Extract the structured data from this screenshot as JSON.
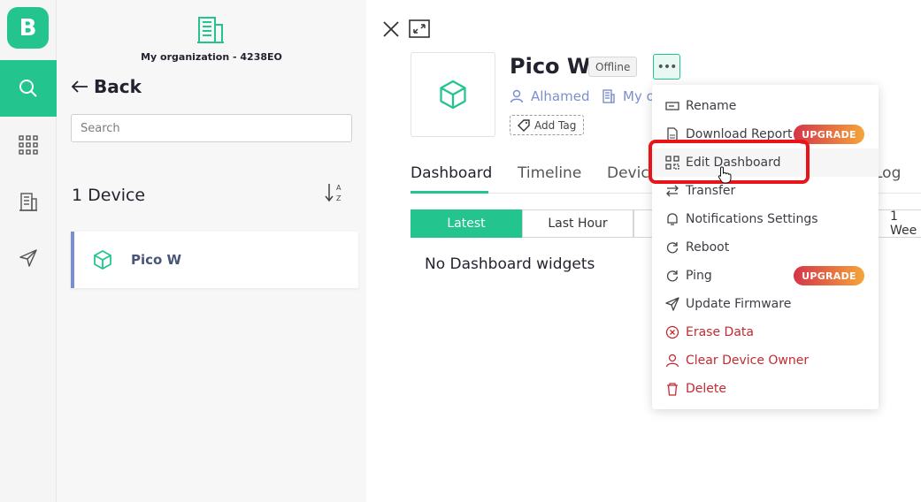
{
  "sidebar": {
    "logo_letter": "B",
    "items": [
      {
        "name": "search-icon",
        "active": true
      },
      {
        "name": "grid-icon",
        "active": false
      },
      {
        "name": "building-icon",
        "active": false
      },
      {
        "name": "send-icon",
        "active": false
      }
    ]
  },
  "panel": {
    "org_name": "My organization - 4238EO",
    "back_label": "Back",
    "search_placeholder": "Search",
    "device_count": "1 Device",
    "sort_label": "A Z",
    "devices": [
      {
        "name": "Pico W"
      }
    ]
  },
  "device": {
    "name": "Pico W",
    "status": "Offline",
    "owner": "Alhamed",
    "org_short": "My o",
    "add_tag": "Add Tag"
  },
  "tabs": [
    "Dashboard",
    "Timeline",
    "Devic",
    "Log"
  ],
  "active_tab": "Dashboard",
  "time_ranges": [
    "Latest",
    "Last Hour",
    "1 Wee"
  ],
  "active_range": "Latest",
  "empty_message": "No Dashboard widgets",
  "menu": {
    "items": [
      {
        "label": "Rename",
        "icon": "rename-icon",
        "danger": false
      },
      {
        "label": "Download Report",
        "icon": "report-icon",
        "danger": false,
        "badge": "UPGRADE"
      },
      {
        "label": "Edit Dashboard",
        "icon": "dashboard-icon",
        "danger": false,
        "highlighted": true
      },
      {
        "label": "Transfer",
        "icon": "transfer-icon",
        "danger": false
      },
      {
        "label": "Notifications Settings",
        "icon": "bell-icon",
        "danger": false
      },
      {
        "label": "Reboot",
        "icon": "reboot-icon",
        "danger": false
      },
      {
        "label": "Ping",
        "icon": "ping-icon",
        "danger": false,
        "badge": "UPGRADE"
      },
      {
        "label": "Update Firmware",
        "icon": "send-icon",
        "danger": false
      },
      {
        "label": "Erase Data",
        "icon": "erase-icon",
        "danger": true
      },
      {
        "label": "Clear Device Owner",
        "icon": "user-icon",
        "danger": true
      },
      {
        "label": "Delete",
        "icon": "trash-icon",
        "danger": true
      }
    ]
  },
  "colors": {
    "accent": "#23c48e",
    "danger": "#c22b32",
    "link": "#7b8fcc",
    "highlight": "#e8141a"
  }
}
